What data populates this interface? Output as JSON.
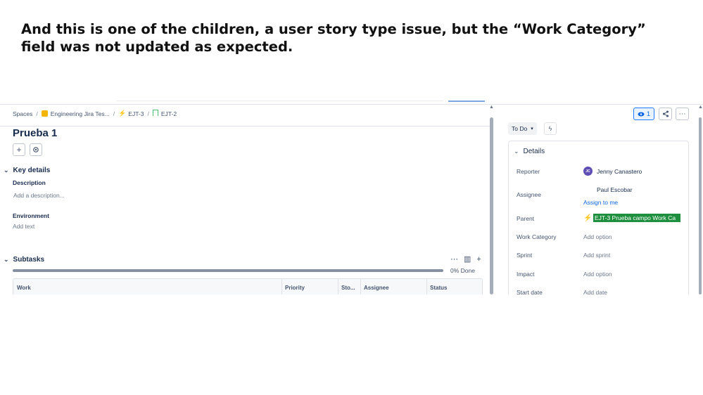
{
  "caption": "And this is one of the children, a user story type issue, but the “Work Category” field was not updated as expected.",
  "breadcrumb": {
    "spaces": "Spaces",
    "project": "Engineering Jira Tes...",
    "epic": "EJT-3",
    "issue": "EJT-2",
    "separator": "/"
  },
  "issue": {
    "title": "Prueba 1",
    "add_icon": "plus-icon",
    "settings_icon": "gear-icon"
  },
  "key_details": {
    "heading": "Key details",
    "description_label": "Description",
    "description_placeholder": "Add a description...",
    "environment_label": "Environment",
    "environment_placeholder": "Add text"
  },
  "subtasks": {
    "heading": "Subtasks",
    "progress_percent": 0,
    "progress_text": "0% Done",
    "columns": [
      "Work",
      "Priority",
      "Sto...",
      "Assignee",
      "Status"
    ]
  },
  "toolbar": {
    "watch_count": "1",
    "status": "To Do"
  },
  "details": {
    "heading": "Details",
    "reporter_label": "Reporter",
    "reporter_initials": "JC",
    "reporter_name": "Jenny Canastero",
    "assignee_label": "Assignee",
    "assignee_name": "Paul Escobar",
    "assign_to_me": "Assign to me",
    "parent_label": "Parent",
    "parent_value": "EJT-3 Prueba campo Work Ca",
    "work_category_label": "Work Category",
    "work_category_value": "Add option",
    "sprint_label": "Sprint",
    "sprint_value": "Add sprint",
    "impact_label": "Impact",
    "impact_value": "Add option",
    "start_date_label": "Start date",
    "start_date_value": "Add date"
  },
  "colors": {
    "accent": "#0c66e4",
    "highlight": "#1e8f3e",
    "story": "#b07be8"
  }
}
